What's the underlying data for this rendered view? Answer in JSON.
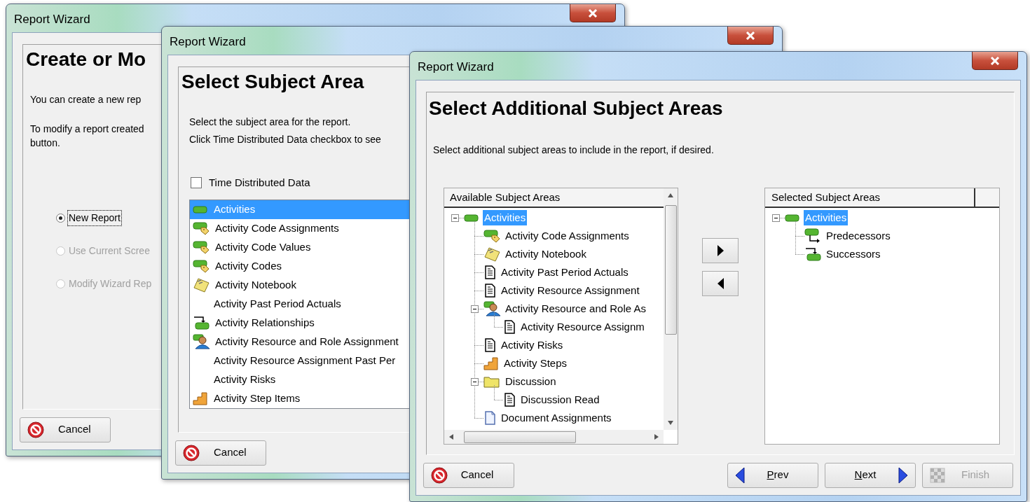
{
  "create_window": {
    "title": "Report Wizard",
    "heading": "Create or Mo",
    "paragraphs": [
      [
        "You can create a new rep"
      ],
      [
        "To modify a report created",
        "button."
      ]
    ],
    "options": [
      {
        "label": "New Report",
        "selected": true,
        "disabled": false,
        "focused": true
      },
      {
        "label": "Use Current Scree",
        "selected": false,
        "disabled": true,
        "focused": false
      },
      {
        "label": "Modify Wizard Rep",
        "selected": false,
        "disabled": true,
        "focused": false
      }
    ],
    "cancel": "Cancel"
  },
  "subject_window": {
    "title": "Report Wizard",
    "heading": "Select Subject Area",
    "paragraphs": [
      "Select the subject area for the report.",
      "Click Time Distributed Data checkbox to see"
    ],
    "checkbox": {
      "label": "Time Distributed Data",
      "checked": false
    },
    "items": [
      {
        "label": "Activities",
        "kind": "bar",
        "selected": true
      },
      {
        "label": "Activity Code Assignments",
        "kind": "tag",
        "selected": false
      },
      {
        "label": "Activity Code Values",
        "kind": "tag",
        "selected": false
      },
      {
        "label": "Activity Codes",
        "kind": "tag",
        "selected": false
      },
      {
        "label": "Activity Notebook",
        "kind": "notebook",
        "selected": false
      },
      {
        "label": "Activity Past Period Actuals",
        "kind": "plain",
        "selected": false
      },
      {
        "label": "Activity Relationships",
        "kind": "successor",
        "selected": false
      },
      {
        "label": "Activity Resource and Role Assignment",
        "kind": "person",
        "selected": false
      },
      {
        "label": "Activity Resource Assignment Past Per",
        "kind": "plain",
        "selected": false
      },
      {
        "label": "Activity Risks",
        "kind": "plain",
        "selected": false
      },
      {
        "label": "Activity Step Items",
        "kind": "steps",
        "selected": false
      }
    ],
    "cancel": "Cancel"
  },
  "additional_window": {
    "title": "Report Wizard",
    "heading": "Select Additional Subject Areas",
    "instruction": "Select additional subject areas to include in the report, if desired.",
    "available": {
      "header": "Available Subject Areas",
      "items": [
        {
          "label": "Activities",
          "kind": "bar",
          "selected": true,
          "expanded": true,
          "children": [
            {
              "label": "Activity Code Assignments",
              "kind": "tag",
              "selected": false
            },
            {
              "label": "Activity Notebook",
              "kind": "notebook",
              "selected": false
            },
            {
              "label": "Activity Past Period Actuals",
              "kind": "document",
              "selected": false
            },
            {
              "label": "Activity Resource Assignment",
              "kind": "document",
              "selected": false
            },
            {
              "label": "Activity Resource and Role As",
              "kind": "person",
              "selected": false,
              "expanded": true,
              "children": [
                {
                  "label": "Activity Resource Assignm",
                  "kind": "document",
                  "selected": false
                }
              ]
            },
            {
              "label": "Activity Risks",
              "kind": "document",
              "selected": false
            },
            {
              "label": "Activity Steps",
              "kind": "steps",
              "selected": false
            },
            {
              "label": "Discussion",
              "kind": "folder",
              "selected": false,
              "expanded": true,
              "children": [
                {
                  "label": "Discussion Read",
                  "kind": "document",
                  "selected": false
                }
              ]
            },
            {
              "label": "Document Assignments",
              "kind": "page",
              "selected": false
            }
          ]
        }
      ]
    },
    "selected_areas": {
      "header": "Selected Subject Areas",
      "items": [
        {
          "label": "Activities",
          "kind": "bar",
          "selected": true,
          "expanded": true,
          "children": [
            {
              "label": "Predecessors",
              "kind": "predecessor",
              "selected": false
            },
            {
              "label": "Successors",
              "kind": "successor",
              "selected": false
            }
          ]
        }
      ]
    },
    "buttons": [
      {
        "label": "Cancel",
        "kind": "cancel",
        "disabled": false,
        "mnemonic": false
      },
      {
        "label": "Prev",
        "kind": "prev",
        "disabled": false,
        "mnemonic": true
      },
      {
        "label": "Next",
        "kind": "next",
        "disabled": false,
        "mnemonic": true
      },
      {
        "label": "Finish",
        "kind": "finish",
        "disabled": true,
        "mnemonic": false
      }
    ]
  }
}
